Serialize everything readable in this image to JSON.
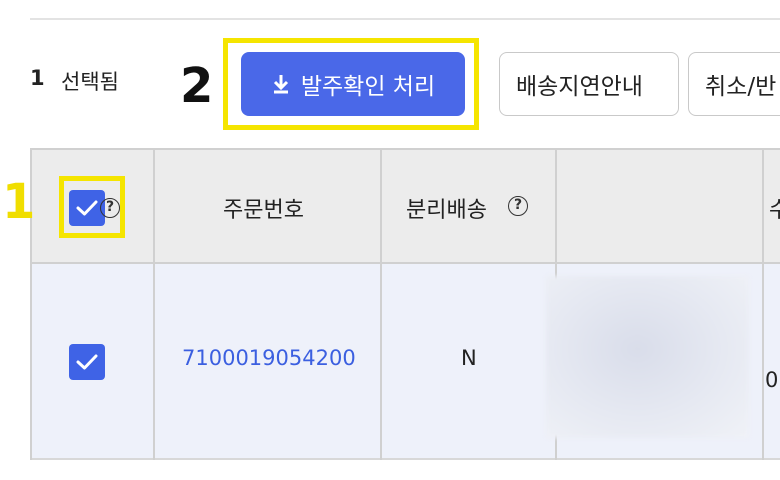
{
  "selection": {
    "count": "1",
    "label": "선택됨"
  },
  "toolbar": {
    "confirm_order_label": "발주확인 처리",
    "delivery_delay_label": "배송지연안내",
    "cancel_label": "취소/반"
  },
  "annotations": {
    "step1": "1",
    "step2": "2",
    "highlight_color": "#f5e500"
  },
  "table": {
    "headers": {
      "order_number": "주문번호",
      "split_shipping": "분리배송",
      "partial_next": "수"
    },
    "help_glyph": "?",
    "rows": [
      {
        "checked": true,
        "order_number": "7100019054200",
        "split_shipping": "N",
        "partial_next": "0"
      }
    ]
  },
  "colors": {
    "primary": "#4a68e8",
    "link": "#3b5fe0",
    "checkbox": "#3f63e6"
  },
  "icons": {
    "download": "download-icon",
    "check": "check-icon",
    "help": "help-circle-icon"
  }
}
